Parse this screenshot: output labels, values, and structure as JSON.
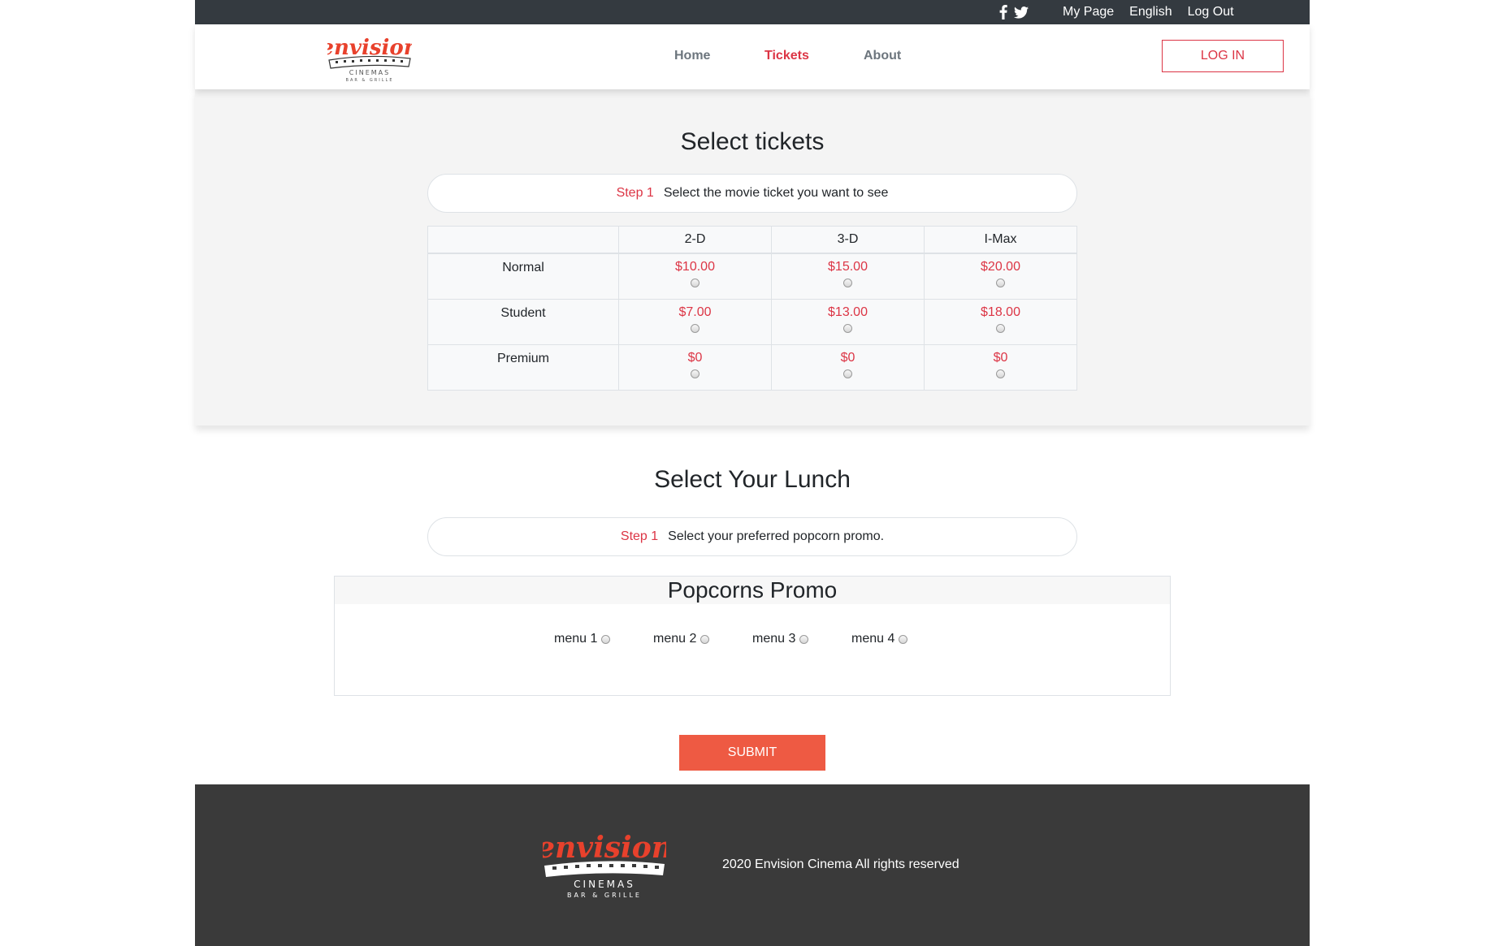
{
  "topbar": {
    "social": [
      "facebook-icon",
      "twitter-icon"
    ],
    "links": [
      "My Page",
      "English",
      "Log Out"
    ]
  },
  "brand": {
    "name": "envision",
    "sub": "CINEMAS",
    "tag": "BAR & GRILLE",
    "accent": "#e8412c"
  },
  "nav": {
    "home": "Home",
    "tickets": "Tickets",
    "about": "About",
    "login": "LOG IN"
  },
  "tickets": {
    "title": "Select tickets",
    "step_label": "Step 1",
    "step_text": "Select the movie ticket you want to see",
    "columns": [
      "",
      "2-D",
      "3-D",
      "I-Max"
    ],
    "rows": [
      {
        "label": "Normal",
        "prices": [
          "$10.00",
          "$15.00",
          "$20.00"
        ]
      },
      {
        "label": "Student",
        "prices": [
          "$7.00",
          "$13.00",
          "$18.00"
        ]
      },
      {
        "label": "Premium",
        "prices": [
          "$0",
          "$0",
          "$0"
        ]
      }
    ]
  },
  "lunch": {
    "title": "Select Your Lunch",
    "step_label": "Step 1",
    "step_text": "Select your preferred popcorn promo.",
    "promo_title": "Popcorns Promo",
    "menus": [
      "menu 1",
      "menu 2",
      "menu 3",
      "menu 4"
    ],
    "submit": "SUBMIT"
  },
  "footer": {
    "copyright": "2020 Envision Cinema All rights reserved"
  },
  "colors": {
    "accent_red": "#dc3545",
    "submit_orange": "#ee5a43",
    "topbar": "#343a40",
    "footer": "#3a3a3a"
  }
}
